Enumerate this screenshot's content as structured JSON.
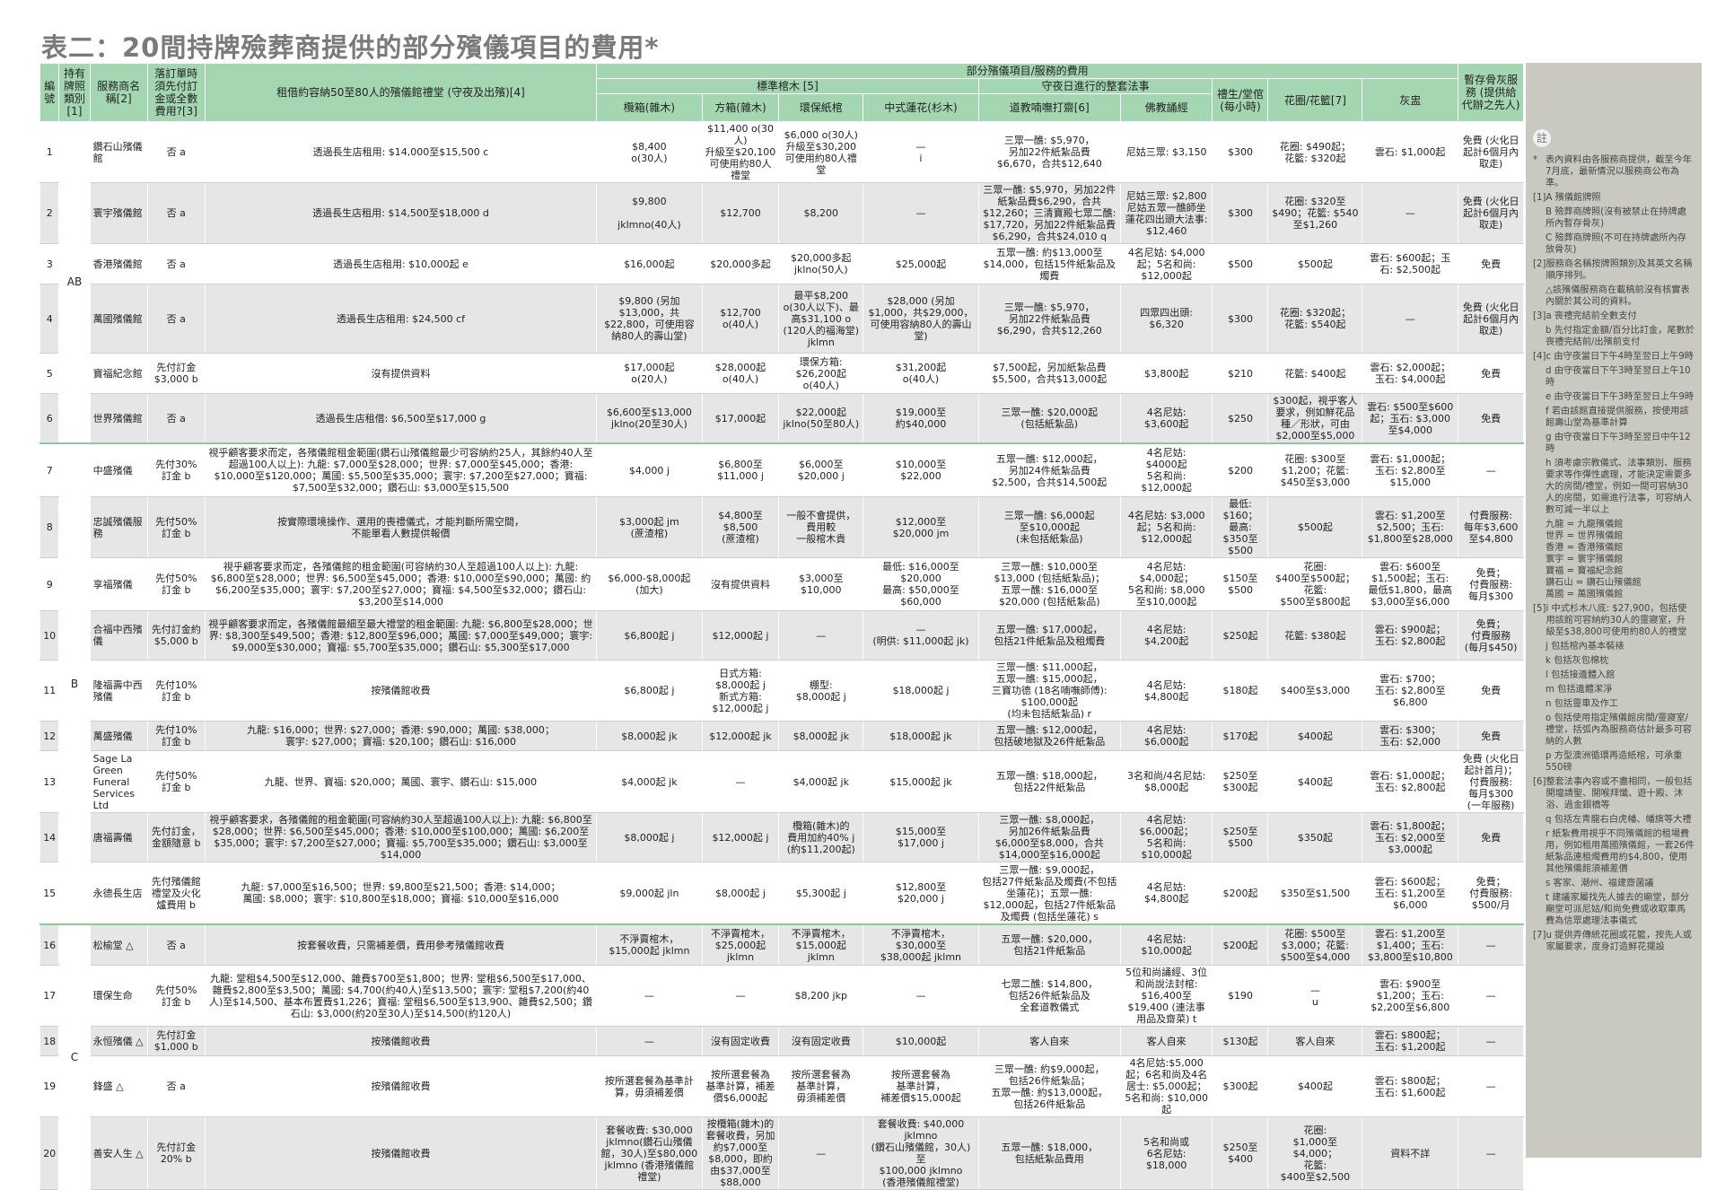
{
  "title": "表二：20間持牌殮葬商提供的部分殯儀項目的費用*",
  "headers": {
    "no": "編號",
    "licence": "持有牌照類別[1]",
    "name": "服務商名稱[2]",
    "deposit": "落訂單時須先付訂金或全數費用?[3]",
    "hall": "租借約容納50至80人的殯儀館禮堂 (守夜及出殯)[4]",
    "group_services": "部分殯儀項目/服務的費用",
    "group_coffin": "標準棺木 [5]",
    "coffin_a": "欖箱(雜木)",
    "coffin_b": "方箱(雜木)",
    "coffin_c": "環保紙棺",
    "coffin_d": "中式蓮花(杉木)",
    "group_ritual": "守夜日進行的整套法事",
    "taoist": "道教喃嘸打齋[6]",
    "buddhist": "佛教誦經",
    "usher": "禮生/堂倌(每小時)",
    "flowers": "花圈/花籃[7]",
    "urn": "灰盅",
    "ash": "暫存骨灰服務 (提供給代辦之先人)"
  },
  "groups": [
    "AB",
    "B",
    "C"
  ],
  "rows": [
    [
      "1",
      "鑽石山殯儀館",
      "否 a",
      "透過長生店租用: $14,000至$15,500 c",
      "$8,400\no(30人)",
      "$11,400 o(30人)\n升級至$20,100可使用約80人禮堂",
      "$6,000 o(30人)\n升級至$30,200可使用約80人禮堂",
      "—\ni",
      "三眾一醮: $5,970，\n另加22件紙紮品費\n$6,670，合共$12,640",
      "尼姑三眾: $3,150",
      "$300",
      "花圈: $490起；\n花籃: $320起",
      "雲石: $1,000起",
      "免費 (火化日起計6個月內取走)"
    ],
    [
      "2",
      "寰宇殯儀館",
      "否 a",
      "透過長生店租用: $14,500至$18,000 d",
      "$9,800\n\njklmno(40人)",
      "$12,700",
      "$8,200",
      "—",
      "三眾一醮: $5,970，另加22件紙紮品費$6,290，合共$12,260；三清寶殿七眾二醮: $17,720，另加22件紙紮品費$6,290，合共$24,010 q",
      "尼姑三眾: $2,800\n尼姑五眾一醮師坐蓮花四出頭大法事: $12,460",
      "$300",
      "花圈: $320至$490；花籃: $540至$1,260",
      "—",
      "免費 (火化日起計6個月內取走)"
    ],
    [
      "3",
      "香港殯儀館",
      "否 a",
      "透過長生店租用: $10,000起 e",
      "$16,000起",
      "$20,000多起",
      "$20,000多起\njklno(50人)",
      "$25,000起",
      "五眾一醮: 約$13,000至$14,000，包括15件紙紮品及燭費",
      "4名尼姑: $4,000起；5名和尚: $12,000起",
      "$500",
      "$500起",
      "雲石: $600起；玉石: $2,500起",
      "免費"
    ],
    [
      "4",
      "萬國殯儀館",
      "否 a",
      "透過長生店租用: $24,500 cf",
      "$9,800 (另加$13,000，共$22,800，可使用容納80人的壽山堂)",
      "$12,700\no(40人)",
      "最平$8,200\no(30人以下)、最高$31,100 o (120人的福海堂)\njklmn",
      "$28,000 (另加$1,000，共$29,000，可使用容納80人的壽山堂)",
      "三眾一醮: $5,970，\n另加22件紙紮品費\n$6,290，合共$12,260",
      "四眾四出頭: $6,320",
      "$300",
      "花圈: $320起；\n花籃: $540起",
      "—",
      "免費 (火化日起計6個月內取走)"
    ],
    [
      "5",
      "寶福紀念館",
      "先付訂金\n$3,000 b",
      "沒有提供資料",
      "$17,000起\no(20人)",
      "$28,000起\no(40人)",
      "環保方箱:\n$26,200起\no(40人)",
      "$31,200起\no(40人)",
      "$7,500起，另加紙紮品費\n$5,500，合共$13,000起",
      "$3,800起",
      "$210",
      "花籃: $400起",
      "雲石: $2,000起；\n玉石: $4,000起",
      "免費"
    ],
    [
      "6",
      "世界殯儀館",
      "否 a",
      "透過長生店租借: $6,500至$17,000 g",
      "$6,600至$13,000\njklno(20至30人)",
      "$17,000起",
      "$22,000起\njklno(50至80人)",
      "$19,000至\n約$40,000",
      "三眾一醮: $20,000起\n(包括紙紮品)",
      "4名尼姑:\n$3,600起",
      "$250",
      "$300起，視乎客人要求，例如鮮花品種／形狀，可由$2,000至$5,000",
      "雲石: $500至$600起；玉石: $3,000至$4,000",
      "免費"
    ],
    [
      "7",
      "中盛殯儀",
      "先付30%訂金 b",
      "視乎顧客要求而定，各殯儀館租金範圍(鑽石山殯儀館最少可容納約25人，其餘約40人至超過100人以上): 九龍: $7,000至$28,000；世界: $7,000至$45,000；香港: $10,000至$120,000；萬國: $5,500至$35,000；寰宇: $7,200至$27,000；寶福: $7,500至$32,000；鑽石山: $3,000至$15,500",
      "$4,000 j",
      "$6,800至\n$11,000 j",
      "$6,000至\n$20,000 j",
      "$10,000至\n$22,000",
      "五眾一醮: $12,000起，\n另加24件紙紮品費\n$2,500，合共$14,500起",
      "4名尼姑:\n$4000起\n5名和尚:\n$12,000起",
      "$200",
      "花圈: $300至\n$1,200；花籃:\n$450至$3,000",
      "雲石: $1,000起；\n玉石: $2,800至\n$15,000",
      "—"
    ],
    [
      "8",
      "忠誠殯儀服務",
      "先付50%訂金 b",
      "按實際環境操作、選用的喪禮儀式，才能判斷所需空間，\n不能單看人數提供報價",
      "$3,000起 jm\n(蔗渣棺)",
      "$4,800至$8,500\n(蔗渣棺)",
      "一般不會提供，\n費用較\n一般棺木貴",
      "$12,000至\n$20,000 jm",
      "三眾一醮: $6,000起\n至$10,000起\n(未包括紙紮品)",
      "4名尼姑: $3,000起；5名和尚: $12,000起",
      "最低: $160；\n最高: $350至\n$500",
      "$500起",
      "雲石: $1,200至\n$2,500；玉石:\n$1,800至$28,000",
      "付費服務:\n每年$3,600\n至$4,800"
    ],
    [
      "9",
      "享福殯儀",
      "先付50%訂金 b",
      "視乎顧客要求而定，各殯儀館的租金範圍(可容納約30人至超過100人以上): 九龍: $6,800至$28,000；世界: $6,500至$45,000；香港: $10,000至$90,000；萬國: 約$6,200至$35,000；寰宇: $7,200至$27,000；寶福: $4,500至$32,000；鑽石山: $3,200至$14,000",
      "$6,000-$8,000起\n(加大)",
      "沒有提供資料",
      "$3,000至\n$10,000",
      "最低: $16,000至\n$20,000\n最高: $50,000至\n$60,000",
      "三眾一醮: $10,000至\n$13,000 (包括紙紮品)；\n五眾一醮: $16,000至\n$20,000 (包括紙紮品)",
      "4名尼姑:\n$4,000起；\n5名和尚: $8,000\n至$10,000起",
      "$150至\n$500",
      "花圈:\n$400至$500起；\n花籃:\n$500至$800起",
      "雲石: $600至\n$1,500起；玉石:\n最低$1,800，最高\n$3,000至$6,000",
      "免費；\n付費服務:\n每月$300"
    ],
    [
      "10",
      "合福中西殯儀",
      "先付訂金約\n$5,000 b",
      "視乎顧客要求而定，各殯儀館最細至最大禮堂的租金範圍: 九龍: $6,800至$28,000；世界: $8,300至$49,500；香港: $12,800至$96,000；萬國: $7,000至$49,000；寰宇: $9,000至$30,000；寶福: $5,700至$35,000；鑽石山: $5,300至$17,000",
      "$6,800起 j",
      "$12,000起 j",
      "—",
      "—\n(明供: $11,000起 jk)",
      "五眾一醮: $17,000起，\n包括21件紙紮品及租燭費",
      "4名尼姑:\n$4,200起",
      "$250起",
      "花籃: $380起",
      "雲石: $900起；\n玉石: $2,800起",
      "免費；\n付費服務\n(每月$450)"
    ],
    [
      "11",
      "隆福壽中西殯儀",
      "先付10%訂金 b",
      "按殯儀館收費",
      "$6,800起 j",
      "日式方箱:\n$8,000起 j\n新式方箱:\n$12,000起 j",
      "棚型:\n$8,000起 j",
      "$18,000起 j",
      "三眾一醮: $11,000起，\n五眾一醮: $15,000起，\n三寶功德 (18名喃嘸師傅):\n$100,000起\n(均未包括紙紮品) r",
      "4名尼姑:\n$4,800起",
      "$180起",
      "$400至$3,000",
      "雲石: $700；\n玉石: $2,800至\n$6,800",
      "免費"
    ],
    [
      "12",
      "萬盛殯儀",
      "先付10%訂金 b",
      "九龍: $16,000；世界: $27,000；香港: $90,000；萬國: $38,000；\n寰宇: $27,000；寶福: $20,100；鑽石山: $16,000",
      "$8,000起 jk",
      "$12,000起 jk",
      "$8,000起 jk",
      "$18,000起 jk",
      "五眾一醮: $12,000起，\n包括破地獄及26件紙紮品",
      "4名尼姑:\n$6,000起",
      "$170起",
      "$400起",
      "雲石: $300；\n玉石: $2,000",
      "免費"
    ],
    [
      "13",
      "Sage La Green Funeral Services Ltd",
      "先付50%訂金 b",
      "九龍、世界、寶福: $20,000；萬國、寰宇、鑽石山: $15,000",
      "$4,000起 jk",
      "—",
      "$4,000起 jk",
      "$15,000起 jk",
      "五眾一醮: $18,000起，\n包括22件紙紮品",
      "3名和尚/4名尼姑:\n$8,000起",
      "$250至\n$300起",
      "$400起",
      "雲石: $1,000起；\n玉石: $2,800起",
      "免費 (火化日起計首月)；\n付費服務:\n每月$300\n(一年服務)"
    ],
    [
      "14",
      "唐福壽儀",
      "先付訂金，金額隨意 b",
      "視乎顧客要求，各殯儀館的租金範圍(可容納約30人至超過100人以上): 九龍: $6,800至$28,000；世界: $6,500至$45,000；香港: $10,000至$100,000；萬國: $6,200至$35,000；寰宇: $7,200至$27,000；寶福: $5,700至$35,000；鑽石山: $3,000至$14,000",
      "$8,000起 j",
      "$12,000起 j",
      "欖箱(雜木)的\n費用加約40% j\n(約$11,200起)",
      "$15,000至\n$17,000 j",
      "三眾一醮: $8,000起，\n另加26件紙紮品費\n$6,000至$8,000，合共\n$14,000至$16,000起",
      "4名尼姑:\n$6,000起；\n5名和尚:\n$10,000起",
      "$250至\n$500",
      "$350起",
      "雲石: $1,800起；\n玉石: $2,000至\n$3,000起",
      "免費"
    ],
    [
      "15",
      "永德長生店",
      "先付殯儀館禮堂及火化爐費用 b",
      "九龍: $7,000至$16,500；世界: $9,800至$21,500；香港: $14,000；\n萬國: $8,000；寰宇: $10,800至$18,000；寶福: $10,000至$16,000",
      "$9,000起 jln",
      "$8,000起 j",
      "$5,300起 j",
      "$12,800至\n$20,000 j",
      "三眾一醮: $9,000起，\n包括27件紙紮品及燭費(不包括坐蓮花)；五眾一醮:\n$12,000起，包括27件紙紮品及燭費 (包括坐蓮花) s",
      "4名尼姑:\n$4,800起",
      "$200起",
      "$350至$1,500",
      "雲石: $600起；\n玉石: $1,200至\n$6,000",
      "免費；\n付費服務:\n$500/月"
    ],
    [
      "16",
      "松榆堂 △",
      "否 a",
      "按套餐收費，只需補差價，費用參考殯儀館收費",
      "不淨賣棺木，\n$15,000起 jklmn",
      "不淨賣棺木，\n$25,000起\njklmn",
      "不淨賣棺木，\n$15,000起\njklmn",
      "不淨賣棺木，\n$30,000至\n$38,000起 jklmn",
      "五眾一醮: $20,000，\n包括21件紙紮品",
      "4名尼姑:\n$10,000起",
      "$200起",
      "花圈: $500至\n$3,000；花籃:\n$500至$4,000",
      "雲石: $1,200至\n$1,400；玉石:\n$3,800至$10,800",
      "—"
    ],
    [
      "17",
      "環保生命",
      "先付50%訂金 b",
      "九龍: 堂租$4,500至$12,000、雜費$700至$1,800；世界: 堂租$6,500至$17,000、雜費$2,800至$3,500；萬國: $4,700(約40人)至$13,500；寰宇: 堂租$7,200(約40人)至$14,500、基本布置費$1,226；寶福: 堂租$6,500至$13,900、雜費$2,500；鑽石山: $3,000(約20至30人)至$14,500(約120人)",
      "—",
      "—",
      "$8,200 jkp",
      "—",
      "七眾二醮: $14,800，\n包括26件紙紮品及\n全套道教儀式",
      "5位和尚誦經、3位和尚說法封棺: $16,400至$19,400 (連法事用品及齋菜) t",
      "$190",
      "—\nu",
      "雲石: $900至\n$1,200；玉石:\n$2,200至$6,800",
      "—"
    ],
    [
      "18",
      "永恒殯儀 △",
      "先付訂金\n$1,000 b",
      "按殯儀館收費",
      "—",
      "沒有固定收費",
      "沒有固定收費",
      "$10,000起",
      "客人自來",
      "客人自來",
      "$130起",
      "客人自來",
      "雲石: $800起；\n玉石: $1,200起",
      "—"
    ],
    [
      "19",
      "鋒盛 △",
      "否 a",
      "按殯儀館收費",
      "按所選套餐為基準計算，毋須補差價",
      "按所選套餐為\n基準計算，補差\n價$6,000起",
      "按所選套餐為\n基準計算，\n毋須補差價",
      "按所選套餐為\n基準計算，\n補差價$15,000起",
      "三眾一醮: 約$9,000起，\n包括26件紙紮品；\n五眾一醮: 約$13,000起，\n包括26件紙紮品",
      "4名尼姑:$5,000起；6名和尚及4名居士: $5,000起；5名和尚: $10,000起",
      "$300起",
      "$400起",
      "雲石: $800起；\n玉石: $1,600起",
      "—"
    ],
    [
      "20",
      "善安人生 △",
      "先付訂金\n20% b",
      "按殯儀館收費",
      "套餐收費: $30,000 jklmno(鑽石山殯儀館，30人)至$80,000 jklmno (香港殯儀館禮堂)",
      "按欖箱(雜木)的套餐收費，另加約$7,000至$8,000，即約由$37,000至$88,000",
      "—",
      "套餐收費: $40,000 jklmno\n(鑽石山殯儀館，30人)至\n$100,000 jklmno\n(香港殯儀館禮堂)",
      "五眾一醮: $18,000，\n包括紙紮品費用",
      "5名和尚或\n6名尼姑:\n$18,000",
      "$250至\n$400",
      "花圈:\n$1,000至$4,000；\n花籃:\n$400至$2,500",
      "資料不詳",
      "—"
    ]
  ],
  "notes_badge": "註",
  "notes": [
    [
      "*",
      "表內資料由各服務商提供，截至今年7月底，最新情況以服務商公布為準。"
    ],
    [
      "[1]",
      "A 殯儀館牌照"
    ],
    [
      "",
      "B 殮葬商牌照(沒有被禁止在持牌處所內暫存骨灰)"
    ],
    [
      "",
      "C 殮葬商牌照(不可在持牌處所內存放骨灰)"
    ],
    [
      "[2]",
      "服務商名稱按牌照類別及其英文名稱順序排列。"
    ],
    [
      "",
      "△該殯儀服務商在載稿前沒有核實表內關於其公司的資料。"
    ],
    [
      "[3]",
      "a 喪禮完結前全數支付"
    ],
    [
      "",
      "b 先付指定金額/百分比訂金，尾數於喪禮完結前/出殯前支付"
    ],
    [
      "[4]",
      "c 由守夜當日下午4時至翌日上午9時"
    ],
    [
      "",
      "d 由守夜當日下午3時至翌日上午10時"
    ],
    [
      "",
      "e 由守夜當日下午3時至翌日上午9時"
    ],
    [
      "",
      "f 若由該館直接提供服務，按使用該館壽山堂為基準計算"
    ],
    [
      "",
      "g 由守夜當日下午3時至翌日中午12時"
    ],
    [
      "",
      "h 須考慮宗教儀式、法事類別、服務要求等作彈性處理，才能決定需要多大的房間/禮堂，例如一間可容納30人的房間，如需進行法事，可容納人數可減一半以上"
    ],
    [
      "",
      "九龍 = 九龍殯儀館\n世界 = 世界殯儀館\n香港 = 香港殯儀館\n寰宇 = 寰宇殯儀館\n寶福 = 寶福紀念館\n鑽石山 = 鑽石山殯儀館\n萬國 = 萬國殯儀館"
    ],
    [
      "[5]",
      "i 中式杉木八底: $27,900，包括使用該館可容納約30人的靈寢室，升級至$38,800可使用約80人的禮堂"
    ],
    [
      "",
      "j 包括棺內基本裝裱"
    ],
    [
      "",
      "k 包括灰包棉枕"
    ],
    [
      "",
      "l 包括接遺體入館"
    ],
    [
      "",
      "m 包括遺體潔淨"
    ],
    [
      "",
      "n 包括靈車及作工"
    ],
    [
      "",
      "o 包括使用指定殯儀館房間/靈寢室/禮堂，括弧內為服務商估計最多可容納的人數"
    ],
    [
      "",
      "p 方型澳洲循環再造紙棺，可承重550磅"
    ],
    [
      "[6]",
      "整套法事內容或不盡相同，一般包括開壇請聖、開喉拜懺、遊十殿、沐浴、過金銀橋等"
    ],
    [
      "",
      "q 包括左青龍右白虎幡、幡旗等大禮"
    ],
    [
      "",
      "r 紙紮費用視乎不同殯儀館的租場費用，例如租用萬國殯儀館，一套26件紙紮品連租燭費用約$4,800，使用其他殯儀館須補差價"
    ],
    [
      "",
      "s 客家、潮州、福建齋菌議"
    ],
    [
      "",
      "t 建議家屬找先人據去的廟堂，部分廟堂可派尼姑/和尚免費或收取車馬費為信眾處理法事儀式"
    ],
    [
      "[7]",
      "u 提供弄傳統花圈或花籃，按先人或家屬要求，度身訂造鮮花擺設"
    ]
  ]
}
